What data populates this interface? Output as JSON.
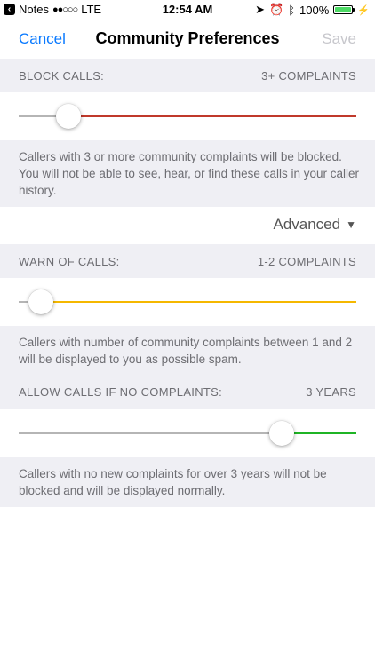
{
  "status_bar": {
    "back_app": "Notes",
    "carrier": "LTE",
    "time": "12:54 AM",
    "battery_percent": "100%",
    "battery_level": 1.0
  },
  "nav": {
    "cancel_label": "Cancel",
    "title": "Community Preferences",
    "save_label": "Save"
  },
  "block": {
    "header": "BLOCK CALLS:",
    "value": "3+ COMPLAINTS",
    "slider_level": 0.12,
    "track_color": "#c0392b",
    "description": "Callers with 3 or more community complaints will be blocked. You will not be able to see, hear, or find these calls in your caller history."
  },
  "advanced": {
    "label": "Advanced"
  },
  "warn": {
    "header": "WARN OF CALLS:",
    "value": "1-2 COMPLAINTS",
    "slider_level": 0.03,
    "track_color": "#f5b800",
    "description": "Callers with number of community complaints between 1 and 2 will be displayed to you as possible spam."
  },
  "allow": {
    "header": "ALLOW CALLS IF NO COMPLAINTS:",
    "value": "3 YEARS",
    "slider_level": 0.8,
    "track_color": "#1fb425",
    "description": "Callers with no new complaints for over 3 years will not be blocked and will be displayed normally."
  }
}
